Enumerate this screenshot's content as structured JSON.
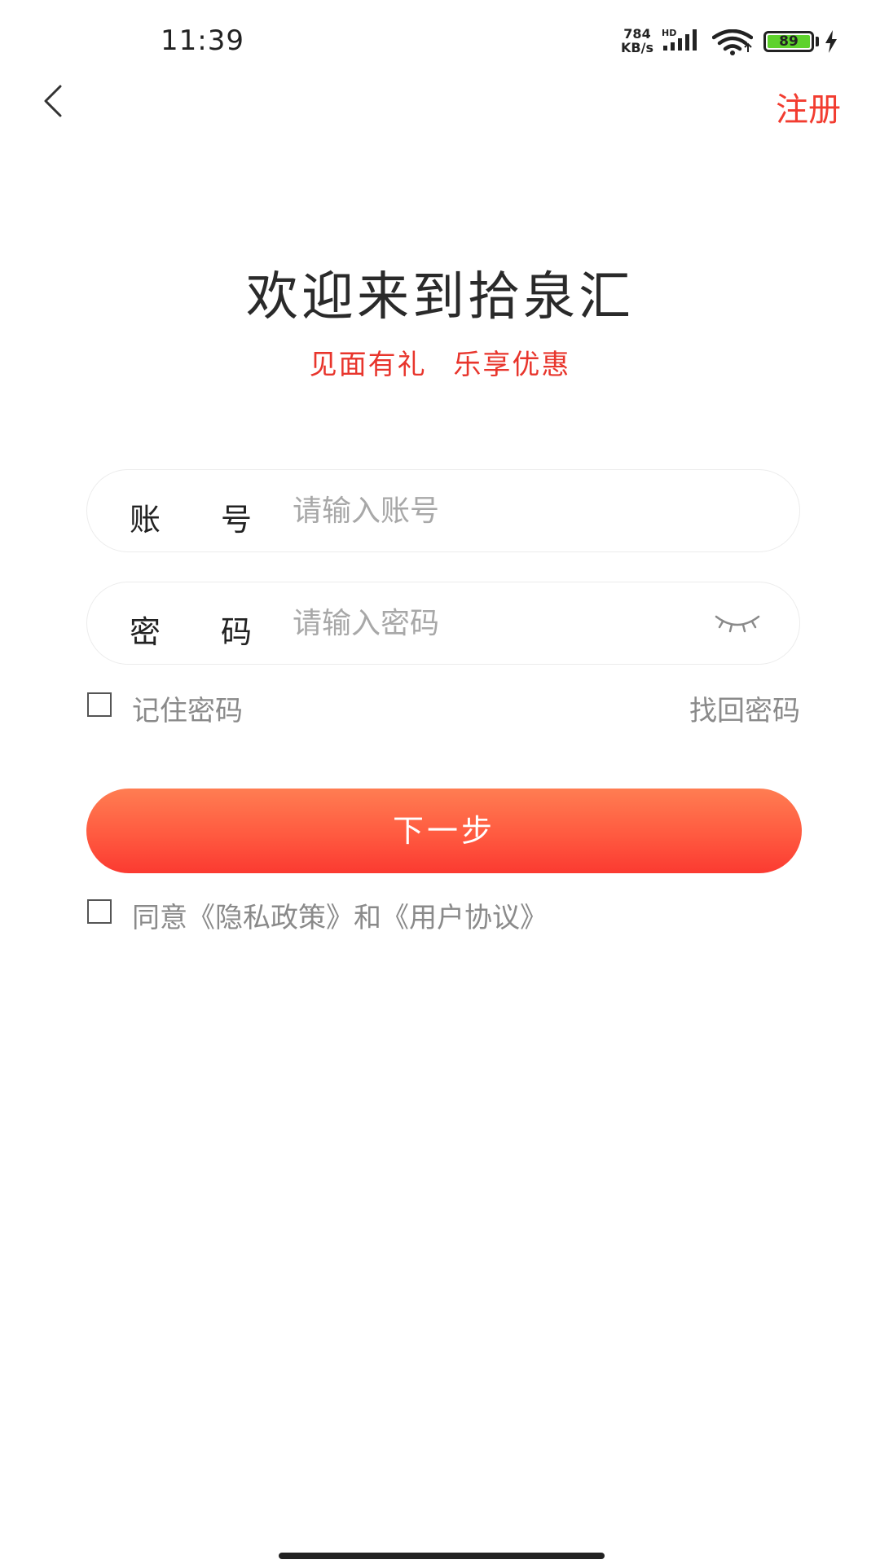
{
  "status_bar": {
    "time": "11:39",
    "net_speed_value": "784",
    "net_speed_unit": "KB/s",
    "network_type": "HD",
    "battery_level": "89",
    "battery_color": "#5ed22c"
  },
  "nav": {
    "back_icon": "chevron-left-icon",
    "register_label": "注册",
    "accent_color": "#f23c30"
  },
  "header": {
    "title": "欢迎来到拾泉汇",
    "slogan": "见面有礼 乐享优惠"
  },
  "form": {
    "account": {
      "label": "账号",
      "placeholder": "请输入账号",
      "value": ""
    },
    "password": {
      "label": "密码",
      "placeholder": "请输入密码",
      "value": "",
      "toggle_icon": "eye-closed-icon"
    },
    "remember": {
      "label": "记住密码",
      "checked": false
    },
    "forgot_label": "找回密码",
    "next_label": "下一步"
  },
  "agreement": {
    "checked": false,
    "prefix": "同意",
    "privacy_link": "《隐私政策》",
    "joiner": "和",
    "terms_link": "《用户协议》"
  }
}
